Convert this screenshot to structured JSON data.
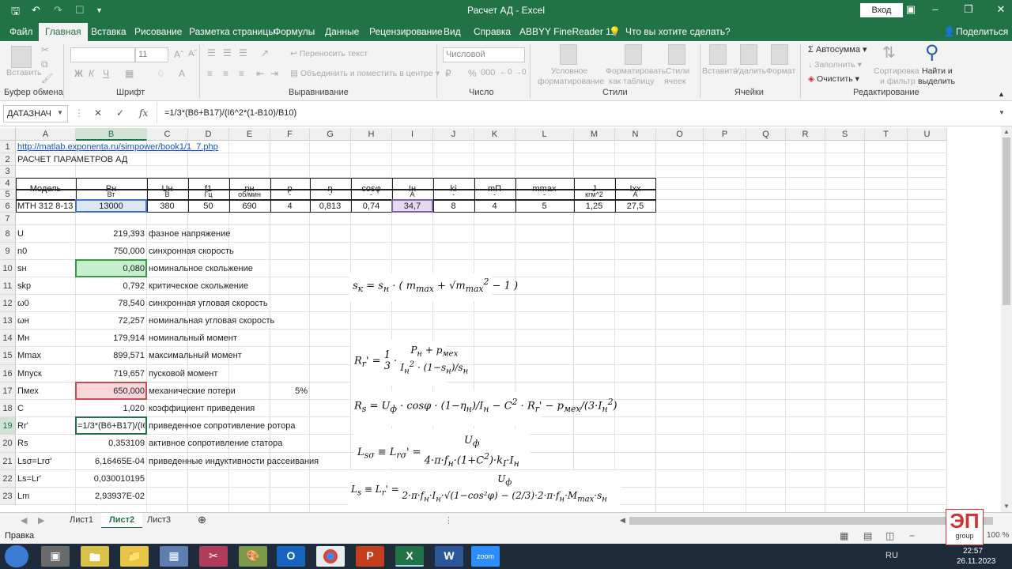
{
  "window": {
    "title": "Расчет АД  -  Excel",
    "signin": "Вход"
  },
  "menu": {
    "tabs": [
      "Файл",
      "Главная",
      "Вставка",
      "Рисование",
      "Разметка страницы",
      "Формулы",
      "Данные",
      "Рецензирование",
      "Вид",
      "Справка",
      "ABBYY FineReader 11"
    ],
    "tell_me": "Что вы хотите сделать?",
    "share": "Поделиться"
  },
  "ribbon": {
    "groups": [
      "Буфер обмена",
      "Шрифт",
      "Выравнивание",
      "Число",
      "Стили",
      "Ячейки",
      "Редактирование"
    ],
    "paste": "Вставить",
    "font_size": "11",
    "wrap_text": "Переносить текст",
    "merge": "Объединить и поместить в центре",
    "number_format": "Числовой",
    "cond_format": [
      "Условное",
      "форматирование"
    ],
    "format_table": [
      "Форматировать",
      "как таблицу"
    ],
    "cell_styles": [
      "Стили",
      "ячеек"
    ],
    "insert": "Вставить",
    "delete": "Удалить",
    "format": "Формат",
    "autosum": "Автосумма",
    "fill": "Заполнить",
    "clear": "Очистить",
    "sort": [
      "Сортировка",
      "и фильтр"
    ],
    "find": [
      "Найти и",
      "выделить"
    ]
  },
  "formula_bar": {
    "name_box": "ДАТАЗНАЧ",
    "formula": "=1/3*(B6+B17)/(I6^2*(1-B10)/B10)"
  },
  "columns": [
    "A",
    "B",
    "C",
    "D",
    "E",
    "F",
    "G",
    "H",
    "I",
    "J",
    "K",
    "L",
    "M",
    "N",
    "O",
    "P",
    "Q",
    "R",
    "S",
    "T",
    "U"
  ],
  "rows": [
    "1",
    "2",
    "3",
    "4",
    "5",
    "6",
    "7",
    "8",
    "9",
    "10",
    "11",
    "12",
    "13",
    "14",
    "15",
    "16",
    "17",
    "18",
    "19",
    "20",
    "21",
    "22",
    "23"
  ],
  "cells": {
    "a1": "http://matlab.exponenta.ru/simpower/book1/1_7.php",
    "a2": "РАСЧЕТ ПАРАМЕТРОВ АД",
    "a4": "Модель",
    "b4": "Pн",
    "c4": "Uн",
    "d4": "f1",
    "e4": "nн",
    "f4": "p",
    "g4": "η",
    "h4": "cosφ",
    "i4": "Iн",
    "j4": "ki",
    "k4": "mП",
    "l4": "mmax",
    "m4": "J",
    "n4": "Ixx",
    "b5": "Вт",
    "c5": "В",
    "d5": "Гц",
    "e5": "об/мин",
    "f5": "-",
    "g5": "-",
    "h5": "-",
    "i5": "А",
    "j5": "-",
    "k5": "-",
    "l5": "-",
    "m5": "кгм^2",
    "n5": "А",
    "a6": "МТН 312 8-13",
    "b6": "13000",
    "c6": "380",
    "d6": "50",
    "e6": "690",
    "f6": "4",
    "g6": "0,813",
    "h6": "0,74",
    "i6": "34,7",
    "j6": "8",
    "k6": "4",
    "l6": "5",
    "m6": "1,25",
    "n6": "27,5",
    "a8": "U",
    "b8": "219,393",
    "c8": "фазное напряжение",
    "a9": "n0",
    "b9": "750,000",
    "c9": "синхронная скорость",
    "a10": "sн",
    "b10": "0,080",
    "c10": "номинальное скольжение",
    "a11": "skp",
    "b11": "0,792",
    "c11": "критическое скольжение",
    "a12": "ω0",
    "b12": "78,540",
    "c12": "синхронная угловая скорость",
    "a13": "ωн",
    "b13": "72,257",
    "c13": "номинальная угловая скорость",
    "a14": "Mн",
    "b14": "179,914",
    "c14": "номинальный момент",
    "a15": "Mmax",
    "b15": "899,571",
    "c15": "максимальный момент",
    "a16": "Mпуск",
    "b16": "719,657",
    "c16": "пусковой момент",
    "a17": "Пмех",
    "b17": "650,000",
    "c17": "механические потери",
    "f17": "5%",
    "a18": "C",
    "b18": "1,020",
    "c18": "коэффициент приведения",
    "a19": "Rr'",
    "b19": "=1/3*(B6+B17)/(I6",
    "c19": "приведенное сопротивление ротора",
    "a20": "Rs",
    "b20": "0,353109",
    "c20": "активное сопротивление статора",
    "a21": "Lsσ=Lrσ'",
    "b21": "6,16465E-04",
    "c21": "приведенные индуктивности рассеивания",
    "a22": "Ls=Lr'",
    "b22": "0,030010195",
    "a23": "Lm",
    "b23": "2,93937E-02"
  },
  "sheets": [
    "Лист1",
    "Лист2",
    "Лист3"
  ],
  "status": {
    "mode": "Правка",
    "zoom": "100 %"
  },
  "tray": {
    "lang": "RU",
    "time": "22:57",
    "date": "26.11.2023"
  },
  "taskbar": {
    "apps": [
      "folder-icon",
      "file-explorer-icon",
      "calculator-icon",
      "scissors-icon",
      "paint-icon",
      "outlook-icon",
      "chrome-icon",
      "powerpoint-icon",
      "excel-icon",
      "word-icon",
      "zoom-icon"
    ],
    "zoom_label": "zoom"
  },
  "logo": {
    "letters": "ЭП",
    "sub": "group"
  }
}
